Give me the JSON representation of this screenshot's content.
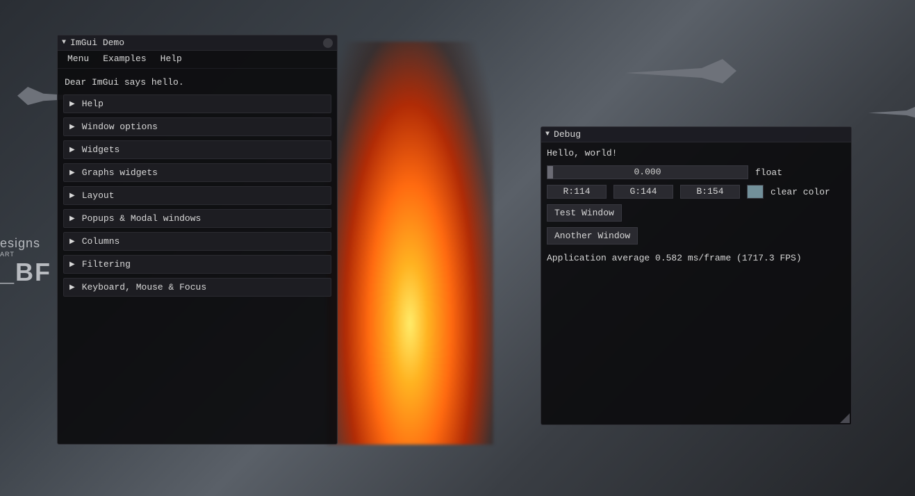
{
  "demo": {
    "title": "ImGui Demo",
    "menu": {
      "menu": "Menu",
      "examples": "Examples",
      "help": "Help"
    },
    "intro": "Dear ImGui says hello.",
    "sections": [
      "Help",
      "Window options",
      "Widgets",
      "Graphs widgets",
      "Layout",
      "Popups & Modal windows",
      "Columns",
      "Filtering",
      "Keyboard, Mouse & Focus"
    ]
  },
  "debug": {
    "title": "Debug",
    "hello": "Hello, world!",
    "float_value": "0.000",
    "float_label": "float",
    "color": {
      "r": "R:114",
      "g": "G:144",
      "b": "B:154",
      "swatch": "#72909a",
      "label": "clear color"
    },
    "btn_test": "Test Window",
    "btn_another": "Another Window",
    "stats": "Application average 0.582 ms/frame (1717.3 FPS)"
  },
  "bg": {
    "l1": "esigns",
    "l2": "ART",
    "l3": "_BF"
  }
}
